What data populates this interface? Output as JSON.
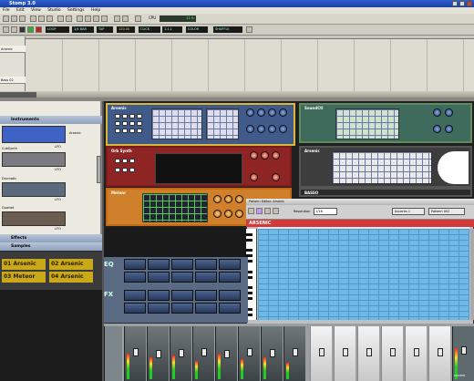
{
  "window": {
    "title": "Stomp 3.0"
  },
  "menu": [
    "File",
    "Edit",
    "View",
    "Studio",
    "Settings",
    "Help"
  ],
  "toolbar": {
    "cpu_label": "CPU",
    "cpu_value": "12 %",
    "buttons": [
      "LOOP",
      "1/4 BAR",
      "TAP",
      "CLICK",
      "COLOR",
      "SHUFFLE"
    ],
    "tempo": "120.00",
    "position": "1.1.1"
  },
  "arrangement": {
    "tracks": [
      "Arsenic",
      "Bass 02"
    ],
    "bars": [
      "1",
      "2",
      "3",
      "4",
      "5",
      "6",
      "7",
      "8",
      "9",
      "10",
      "11",
      "12",
      "13",
      "14",
      "15",
      "16",
      "17",
      "18",
      "19",
      "20",
      "21"
    ]
  },
  "browser": {
    "instruments_label": "Instruments",
    "effects_label": "Effects",
    "samples_label": "Samples",
    "instruments": [
      {
        "name": "Arsenic",
        "tag": "LFO"
      },
      {
        "name": "CubSynth",
        "tag": "LFO"
      },
      {
        "name": "Drumatic",
        "tag": "LFO"
      },
      {
        "name": "Quartet",
        "tag": "LFO"
      }
    ],
    "samples": [
      "01 Arsenic",
      "02 Arsenic",
      "03 Meteor",
      "04 Arsenic"
    ]
  },
  "rack": {
    "units": [
      "Arsenic",
      "SoundCtl",
      "Orb Synth",
      "Arsenic",
      "Meteor",
      "BASSO"
    ]
  },
  "editor": {
    "title": "Pattern Editor: Arsenic",
    "resolution_label": "Resolution",
    "resolution_value": "1/16",
    "header": "ARSENIC",
    "accents_label": "Accents 1",
    "pattern_label": "Pattern 002"
  },
  "mixer": {
    "eq_label": "EQ",
    "fx_label": "FX",
    "master_label": "MASTER"
  }
}
